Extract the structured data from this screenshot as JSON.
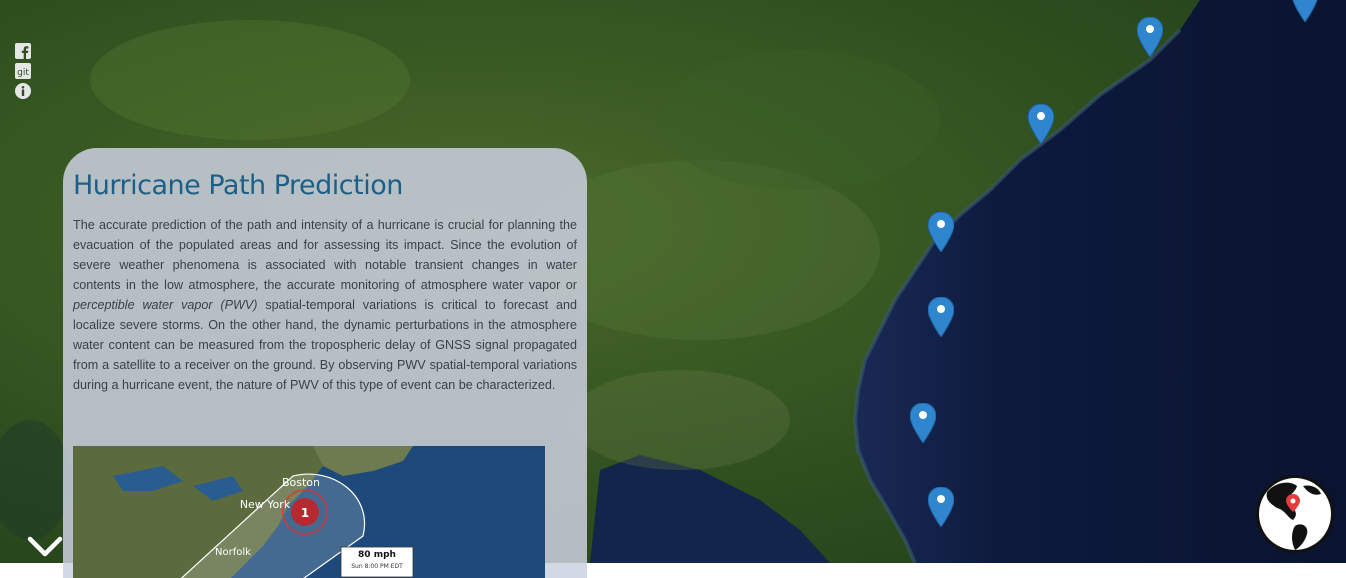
{
  "social": {
    "facebook_icon": "facebook-icon",
    "git_label": "git",
    "info_icon": "info-icon"
  },
  "panel": {
    "title": "Hurricane Path Prediction",
    "body_part1": "The accurate prediction of the path and intensity of a hurricane is crucial for planning the evacuation of the populated areas and for assessing its impact. Since the evolution of severe weather phenomena is associated with notable transient changes in water contents in the low atmosphere, the accurate monitoring of atmosphere water vapor or ",
    "body_em": "perceptible water vapor (PWV)",
    "body_part2": " spatial-temporal variations is critical to forecast and localize severe storms. On the other hand, the dynamic perturbations in the atmosphere water content can be measured from the tropospheric delay of GNSS signal propagated from a satellite to a receiver on the ground. By observing PWV spatial-temporal variations during a hurricane event, the nature of PWV of this type of event can be characterized."
  },
  "thumbnail": {
    "city_boston": "Boston",
    "city_newyork": "New York",
    "city_norfolk": "Norfolk",
    "storm_category": "1",
    "wind_speed": "80 mph",
    "time_label": "Sun 8:00 PM EDT"
  },
  "colors": {
    "title": "#1d5f88",
    "marker": "#2f86cf",
    "ocean": "#0c1733",
    "land": "#2e4f1f"
  },
  "markers": [
    "marker-1",
    "marker-2",
    "marker-3",
    "marker-4",
    "marker-5",
    "marker-6",
    "marker-7"
  ],
  "controls": {
    "scroll_icon": "chevron-down-icon",
    "globe_icon": "globe-icon"
  }
}
